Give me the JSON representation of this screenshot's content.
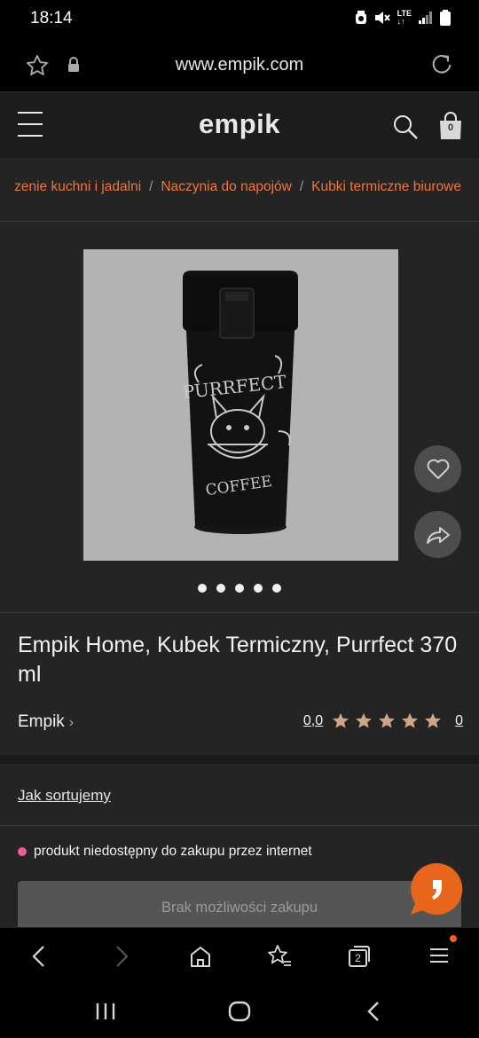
{
  "status_bar": {
    "time": "18:14",
    "network": "LTE",
    "icons": [
      "alarm-icon",
      "mute-icon",
      "lte-signal-icon",
      "signal-bars-icon",
      "battery-icon"
    ]
  },
  "browser": {
    "url": "www.empik.com",
    "tab_count": "2"
  },
  "header": {
    "logo": "empik",
    "cart_count": "0"
  },
  "breadcrumb": [
    {
      "label": "zenie kuchni i jadalni"
    },
    {
      "label": "Naczynia do napojów"
    },
    {
      "label": "Kubki termiczne biurowe"
    }
  ],
  "gallery": {
    "image_text_top": "PURRFECT",
    "image_text_bottom": "COFFEE",
    "slide_count": 5
  },
  "product": {
    "title": "Empik Home, Kubek Termiczny, Purrfect 370 ml",
    "brand": "Empik",
    "rating_score": "0,0",
    "rating_count": "0",
    "stars": 5
  },
  "sorting": {
    "label": "Jak sortujemy"
  },
  "availability": {
    "status": "produkt niedostępny do zakupu przez internet",
    "button_label": "Brak możliwości zakupu"
  },
  "colors": {
    "accent": "#f2743a",
    "status_dot": "#ee5c9e",
    "chat": "#e8661c",
    "panel": "#242424"
  }
}
